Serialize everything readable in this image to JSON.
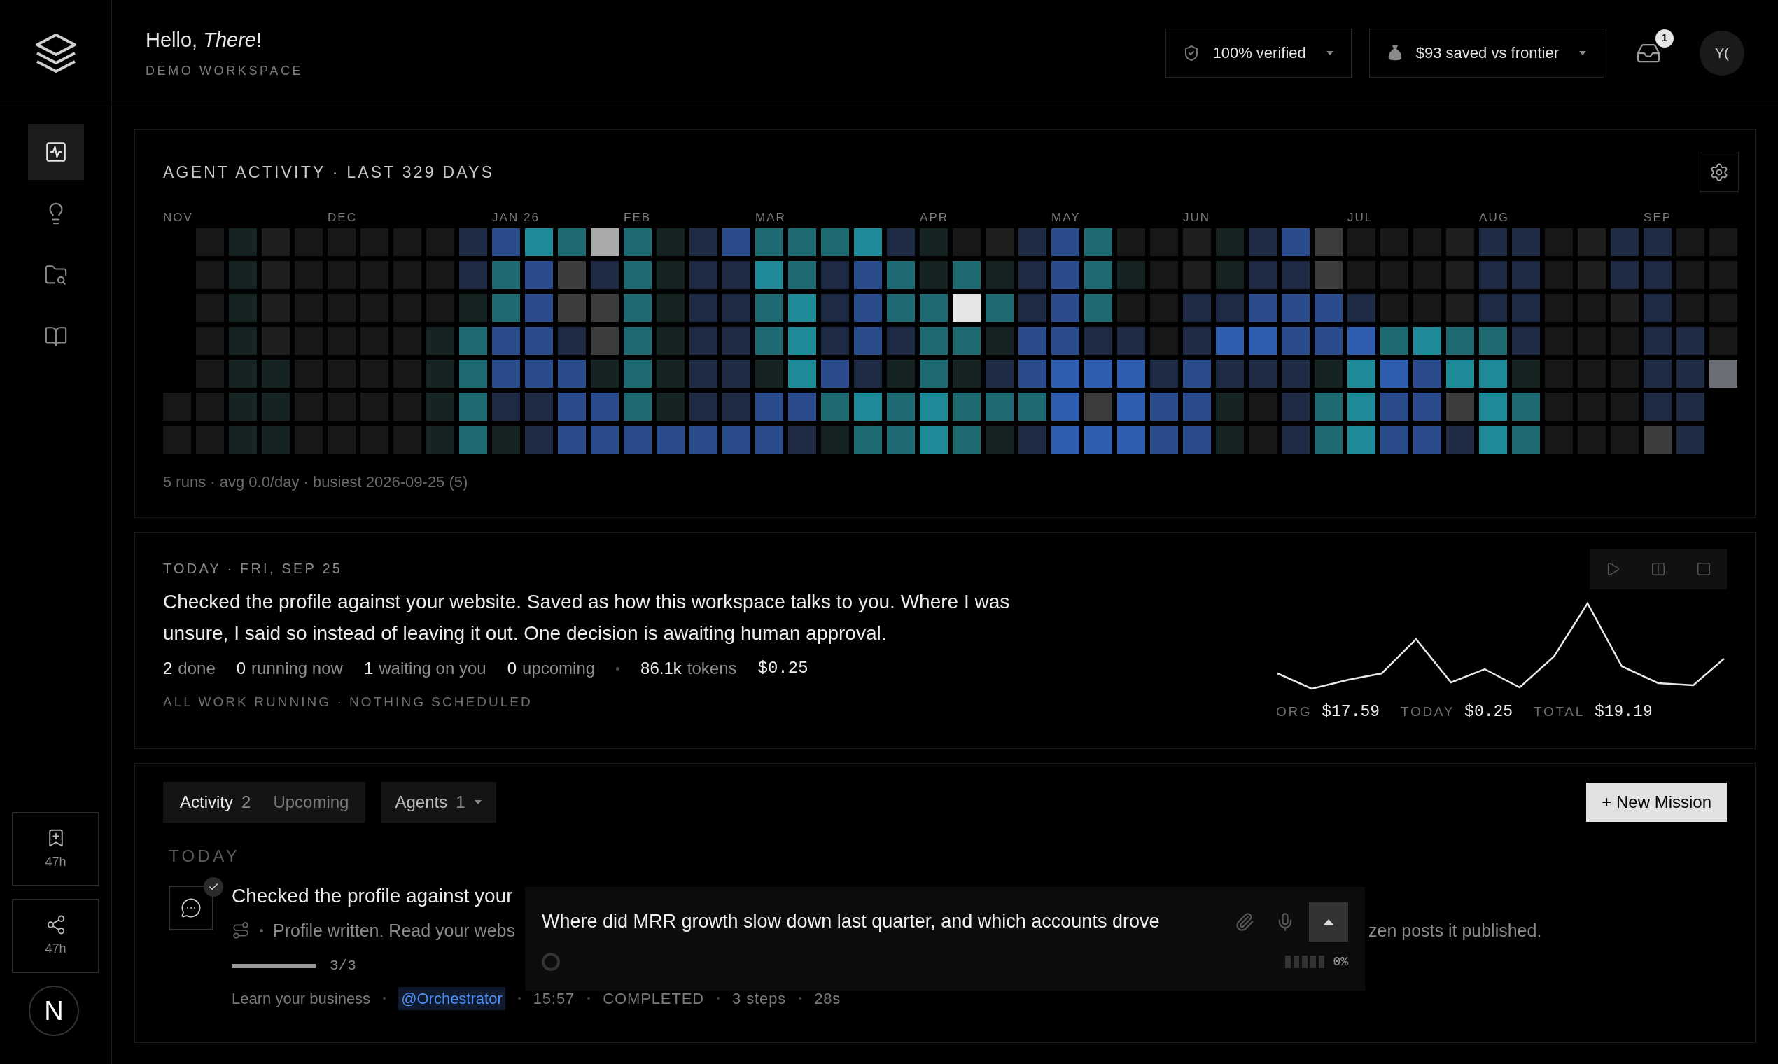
{
  "sidebar": {
    "nav": [
      {
        "kind": "activity",
        "selected": true
      },
      {
        "kind": "ideas",
        "selected": false
      },
      {
        "kind": "folders",
        "selected": false
      },
      {
        "kind": "docs",
        "selected": false
      }
    ],
    "shortcuts": [
      {
        "kind": "bookmark",
        "label": "47h"
      },
      {
        "kind": "share",
        "label": "47h"
      }
    ],
    "dev_badge": "N"
  },
  "header": {
    "greeting": "Hello, *There*!",
    "workspace": "DEMO WORKSPACE",
    "pills": [
      {
        "kind": "verified",
        "label": "100% verified"
      },
      {
        "kind": "savings",
        "label": "$93 saved vs frontier"
      }
    ],
    "inbox_count": "1",
    "avatar": "Y("
  },
  "activity_card": {
    "title": "AGENT ACTIVITY · LAST 329 DAYS",
    "months": [
      "NOV",
      "DEC",
      "JAN 26",
      "FEB",
      "MAR",
      "APR",
      "MAY",
      "JUN",
      "JUL",
      "AUG",
      "SEP"
    ],
    "summary": "5 runs · avg 0.0/day · busiest 2026-09-25 (5)"
  },
  "today_card": {
    "date": "TODAY · FRI, SEP 25",
    "message": "Checked the profile against your website. Saved as how this workspace talks to you. Where I was unsure, I said so instead of leaving it out. One decision is awaiting human approval.",
    "stats": [
      {
        "count": "2",
        "caption": "done"
      },
      {
        "count": "0",
        "caption": "running now"
      },
      {
        "count": "1",
        "caption": "waiting on you"
      },
      {
        "count": "0",
        "caption": "upcoming"
      }
    ],
    "tokens": {
      "count": "86.1k",
      "caption": "tokens"
    },
    "cost": "$0.25",
    "status": "ALL WORK RUNNING · NOTHING SCHEDULED",
    "controls": [
      {
        "kind": "play"
      },
      {
        "kind": "pause"
      },
      {
        "kind": "stop"
      }
    ],
    "totals": [
      {
        "label": "ORG",
        "value": "$17.59"
      },
      {
        "label": "TODAY",
        "value": "$0.25"
      },
      {
        "label": "TOTAL",
        "value": "$19.19"
      }
    ]
  },
  "missions": {
    "tabs": [
      {
        "label": "Activity",
        "count": "2",
        "selected": true
      },
      {
        "label": "Upcoming",
        "selected": false
      }
    ],
    "agents_filter": {
      "label": "Agents",
      "count": "1"
    },
    "new_button": "+ New Mission",
    "section": "TODAY",
    "items": [
      {
        "title": "Checked the profile against your",
        "summary_start": "Profile written. Read your webs",
        "summary_end": "zen posts it published.",
        "done": true,
        "level": 1,
        "progress": "3/3",
        "mission": "Learn your business",
        "agent": "@Orchestrator",
        "meta": [
          "15:57",
          "COMPLETED",
          "3 steps",
          "28s"
        ]
      }
    ]
  },
  "composer": {
    "value": "Where did MRR growth slow down last quarter, and which accounts drove",
    "meter": "0%"
  }
}
